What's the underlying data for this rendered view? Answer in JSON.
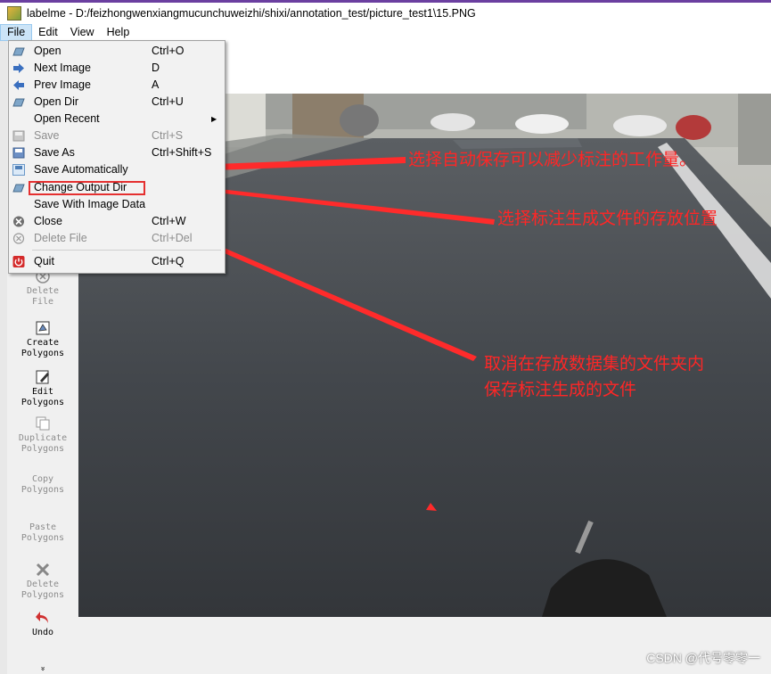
{
  "window": {
    "title": "labelme - D:/feizhongwenxiangmucunchuweizhi/shixi/annotation_test/picture_test1\\15.PNG"
  },
  "menubar": {
    "items": [
      "File",
      "Edit",
      "View",
      "Help"
    ]
  },
  "file_menu": {
    "items": [
      {
        "label": "Open",
        "shortcut": "Ctrl+O",
        "icon": "open-icon",
        "enabled": true
      },
      {
        "label": "Next Image",
        "shortcut": "D",
        "icon": "next-arrow-icon",
        "enabled": true
      },
      {
        "label": "Prev Image",
        "shortcut": "A",
        "icon": "prev-arrow-icon",
        "enabled": true
      },
      {
        "label": "Open Dir",
        "shortcut": "Ctrl+U",
        "icon": "open-dir-icon",
        "enabled": true
      },
      {
        "label": "Open Recent",
        "shortcut": "",
        "icon": "",
        "enabled": true,
        "submenu": true
      },
      {
        "label": "Save",
        "shortcut": "Ctrl+S",
        "icon": "save-icon",
        "enabled": false
      },
      {
        "label": "Save As",
        "shortcut": "Ctrl+Shift+S",
        "icon": "save-as-icon",
        "enabled": true
      },
      {
        "label": "Save Automatically",
        "shortcut": "",
        "icon": "save-auto-icon",
        "enabled": true
      },
      {
        "label": "Change Output Dir",
        "shortcut": "",
        "icon": "output-dir-icon",
        "enabled": true
      },
      {
        "label": "Save With Image Data",
        "shortcut": "",
        "icon": "",
        "enabled": true
      },
      {
        "label": "Close",
        "shortcut": "Ctrl+W",
        "icon": "close-icon",
        "enabled": true
      },
      {
        "label": "Delete File",
        "shortcut": "Ctrl+Del",
        "icon": "delete-file-icon",
        "enabled": false
      },
      {
        "label": "Quit",
        "shortcut": "Ctrl+Q",
        "icon": "quit-icon",
        "enabled": true
      }
    ]
  },
  "toolbar": {
    "items": [
      {
        "label": "Delete\nFile",
        "icon": "delete-file-icon",
        "enabled": false
      },
      {
        "label": "Create\nPolygons",
        "icon": "create-polygons-icon",
        "enabled": true
      },
      {
        "label": "Edit\nPolygons",
        "icon": "edit-polygons-icon",
        "enabled": true
      },
      {
        "label": "Duplicate\nPolygons",
        "icon": "duplicate-polygons-icon",
        "enabled": false
      },
      {
        "label": "Copy\nPolygons",
        "icon": "",
        "enabled": false
      },
      {
        "label": "Paste\nPolygons",
        "icon": "",
        "enabled": false
      },
      {
        "label": "Delete\nPolygons",
        "icon": "delete-polygons-icon",
        "enabled": false
      },
      {
        "label": "Undo",
        "icon": "undo-icon",
        "enabled": true
      }
    ],
    "more": "»"
  },
  "annotations": {
    "a1": "选择自动保存可以减少标注的工作量。",
    "a2": "选择标注生成文件的存放位置",
    "a3_line1": "取消在存放数据集的文件夹内",
    "a3_line2": "保存标注生成的文件"
  },
  "watermark": "CSDN @代号零零一",
  "colors": {
    "annotation": "#ff2626",
    "title_accent": "#6b3fa0",
    "menu_highlight": "#cce4f7"
  }
}
